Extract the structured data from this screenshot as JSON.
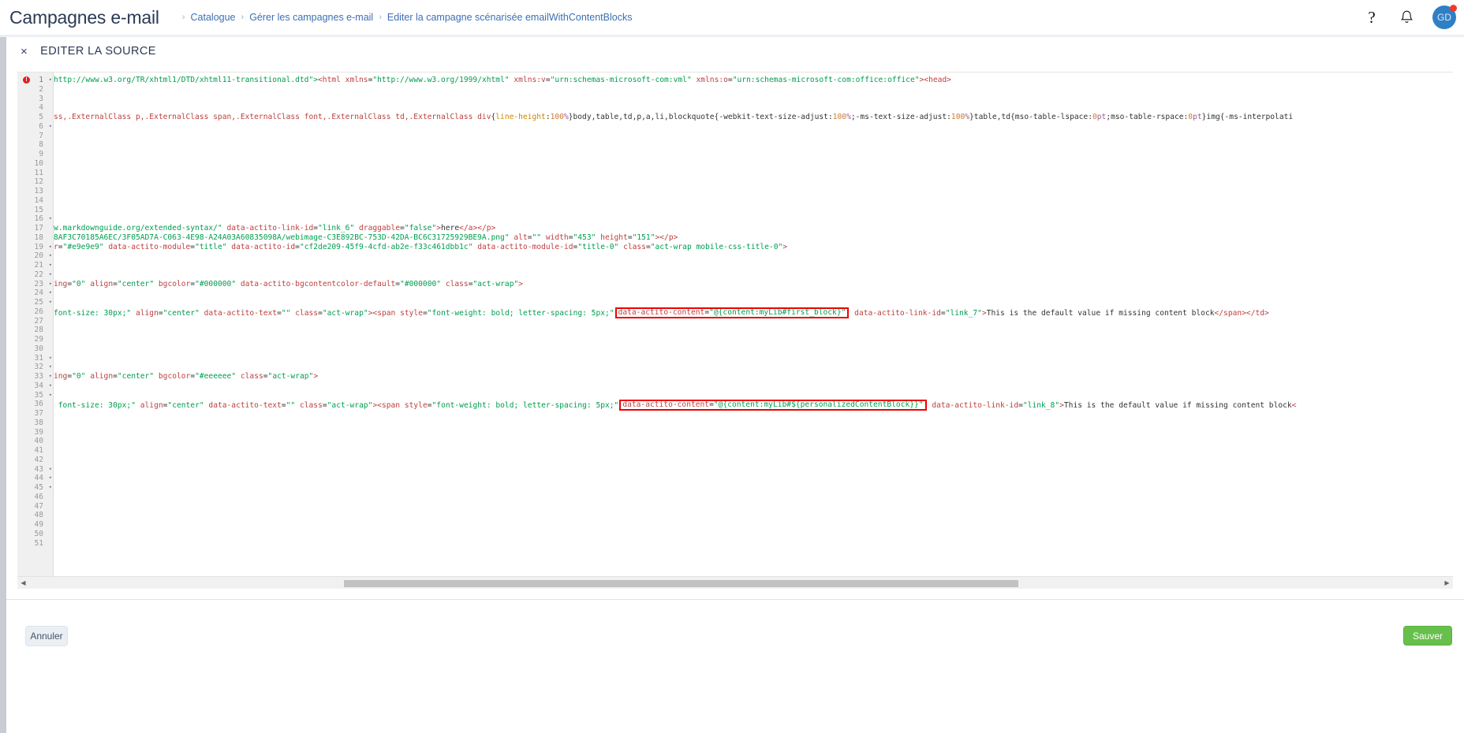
{
  "header": {
    "title": "Campagnes e-mail",
    "breadcrumb": [
      {
        "label": "Catalogue"
      },
      {
        "label": "Gérer les campagnes e-mail"
      },
      {
        "label": "Editer la campagne scénarisée emailWithContentBlocks"
      }
    ],
    "separator": "›",
    "help_icon": "?",
    "bell_icon": "bell-icon",
    "avatar_initials": "GD"
  },
  "panel": {
    "close_label": "×",
    "title": "EDITER LA SOURCE"
  },
  "editor": {
    "error_marker": "!",
    "total_lines": 51,
    "fold_lines": [
      1,
      6,
      16,
      19,
      20,
      21,
      22,
      23,
      24,
      25,
      31,
      32,
      33,
      34,
      35,
      43,
      44,
      45
    ],
    "lines": [
      {
        "n": 1,
        "tokens": [
          {
            "t": "http://www.w3.org/TR/xhtml1/DTD/xhtml11-transitional.dtd\">",
            "c": "t-str"
          },
          {
            "t": "<html ",
            "c": "t-tag"
          },
          {
            "t": "xmlns",
            "c": "t-attr"
          },
          {
            "t": "=",
            "c": "t-plain"
          },
          {
            "t": "\"http://www.w3.org/1999/xhtml\"",
            "c": "t-str"
          },
          {
            "t": " ",
            "c": "t-plain"
          },
          {
            "t": "xmlns:v",
            "c": "t-attr"
          },
          {
            "t": "=",
            "c": "t-plain"
          },
          {
            "t": "\"urn:schemas-microsoft-com:vml\"",
            "c": "t-str"
          },
          {
            "t": " ",
            "c": "t-plain"
          },
          {
            "t": "xmlns:o",
            "c": "t-attr"
          },
          {
            "t": "=",
            "c": "t-plain"
          },
          {
            "t": "\"urn:schemas-microsoft-com:office:office\"",
            "c": "t-str"
          },
          {
            "t": "><head>",
            "c": "t-tag"
          }
        ]
      },
      {
        "n": 5,
        "tokens": [
          {
            "t": "ss,.ExternalClass p,.ExternalClass span,.ExternalClass font,.ExternalClass td,.ExternalClass div",
            "c": "t-attr"
          },
          {
            "t": "{",
            "c": "t-plain"
          },
          {
            "t": "line-height",
            "c": "t-css-prop"
          },
          {
            "t": ":",
            "c": "t-plain"
          },
          {
            "t": "100",
            "c": "t-num"
          },
          {
            "t": "%",
            "c": "t-pct"
          },
          {
            "t": "}body,table,td,p,a,li,blockquote{-webkit-text-size-adjust:",
            "c": "t-plain"
          },
          {
            "t": "100",
            "c": "t-num"
          },
          {
            "t": "%",
            "c": "t-pct"
          },
          {
            "t": ";-ms-text-size-adjust:",
            "c": "t-plain"
          },
          {
            "t": "100",
            "c": "t-num"
          },
          {
            "t": "%",
            "c": "t-pct"
          },
          {
            "t": "}table,td{mso-table-lspace:",
            "c": "t-plain"
          },
          {
            "t": "0",
            "c": "t-num"
          },
          {
            "t": "pt",
            "c": "t-pct"
          },
          {
            "t": ";mso-table-rspace:",
            "c": "t-plain"
          },
          {
            "t": "0",
            "c": "t-num"
          },
          {
            "t": "pt",
            "c": "t-pct"
          },
          {
            "t": "}img{-ms-interpolati",
            "c": "t-plain"
          }
        ]
      },
      {
        "n": 17,
        "tokens": [
          {
            "t": "w.markdownguide.org/extended-syntax/\"",
            "c": "t-str"
          },
          {
            "t": " ",
            "c": "t-plain"
          },
          {
            "t": "data-actito-link-id",
            "c": "t-attr"
          },
          {
            "t": "=",
            "c": "t-plain"
          },
          {
            "t": "\"link_6\"",
            "c": "t-str"
          },
          {
            "t": " ",
            "c": "t-plain"
          },
          {
            "t": "draggable",
            "c": "t-attr"
          },
          {
            "t": "=",
            "c": "t-plain"
          },
          {
            "t": "\"false\"",
            "c": "t-str"
          },
          {
            "t": ">",
            "c": "t-tag"
          },
          {
            "t": "here",
            "c": "t-text"
          },
          {
            "t": "</a></p>",
            "c": "t-tag"
          }
        ]
      },
      {
        "n": 18,
        "tokens": [
          {
            "t": "8AF3C70185A6EC/3F05AD7A-C063-4E98-A24A03A60835098A/webimage-C3E892BC-753D-42DA-BC6C31725929BE9A.png\"",
            "c": "t-str"
          },
          {
            "t": " ",
            "c": "t-plain"
          },
          {
            "t": "alt",
            "c": "t-attr"
          },
          {
            "t": "=",
            "c": "t-plain"
          },
          {
            "t": "\"\"",
            "c": "t-str"
          },
          {
            "t": " ",
            "c": "t-plain"
          },
          {
            "t": "width",
            "c": "t-attr"
          },
          {
            "t": "=",
            "c": "t-plain"
          },
          {
            "t": "\"453\"",
            "c": "t-str"
          },
          {
            "t": " ",
            "c": "t-plain"
          },
          {
            "t": "height",
            "c": "t-attr"
          },
          {
            "t": "=",
            "c": "t-plain"
          },
          {
            "t": "\"151\"",
            "c": "t-str"
          },
          {
            "t": "></p>",
            "c": "t-tag"
          }
        ]
      },
      {
        "n": 19,
        "tokens": [
          {
            "t": "r",
            "c": "t-attr"
          },
          {
            "t": "=",
            "c": "t-plain"
          },
          {
            "t": "\"#e9e9e9\"",
            "c": "t-str"
          },
          {
            "t": " ",
            "c": "t-plain"
          },
          {
            "t": "data-actito-module",
            "c": "t-attr"
          },
          {
            "t": "=",
            "c": "t-plain"
          },
          {
            "t": "\"title\"",
            "c": "t-str"
          },
          {
            "t": " ",
            "c": "t-plain"
          },
          {
            "t": "data-actito-id",
            "c": "t-attr"
          },
          {
            "t": "=",
            "c": "t-plain"
          },
          {
            "t": "\"cf2de209-45f9-4cfd-ab2e-f33c461dbb1c\"",
            "c": "t-str"
          },
          {
            "t": " ",
            "c": "t-plain"
          },
          {
            "t": "data-actito-module-id",
            "c": "t-attr"
          },
          {
            "t": "=",
            "c": "t-plain"
          },
          {
            "t": "\"title-0\"",
            "c": "t-str"
          },
          {
            "t": " ",
            "c": "t-plain"
          },
          {
            "t": "class",
            "c": "t-attr"
          },
          {
            "t": "=",
            "c": "t-plain"
          },
          {
            "t": "\"act-wrap mobile-css-title-0\"",
            "c": "t-str"
          },
          {
            "t": ">",
            "c": "t-tag"
          }
        ]
      },
      {
        "n": 23,
        "tokens": [
          {
            "t": "ing",
            "c": "t-attr"
          },
          {
            "t": "=",
            "c": "t-plain"
          },
          {
            "t": "\"0\"",
            "c": "t-str"
          },
          {
            "t": " ",
            "c": "t-plain"
          },
          {
            "t": "align",
            "c": "t-attr"
          },
          {
            "t": "=",
            "c": "t-plain"
          },
          {
            "t": "\"center\"",
            "c": "t-str"
          },
          {
            "t": " ",
            "c": "t-plain"
          },
          {
            "t": "bgcolor",
            "c": "t-attr"
          },
          {
            "t": "=",
            "c": "t-plain"
          },
          {
            "t": "\"#000000\"",
            "c": "t-str"
          },
          {
            "t": " ",
            "c": "t-plain"
          },
          {
            "t": "data-actito-bgcontentcolor-default",
            "c": "t-attr"
          },
          {
            "t": "=",
            "c": "t-plain"
          },
          {
            "t": "\"#000000\"",
            "c": "t-str"
          },
          {
            "t": " ",
            "c": "t-plain"
          },
          {
            "t": "class",
            "c": "t-attr"
          },
          {
            "t": "=",
            "c": "t-plain"
          },
          {
            "t": "\"act-wrap\"",
            "c": "t-str"
          },
          {
            "t": ">",
            "c": "t-tag"
          }
        ]
      },
      {
        "n": 26,
        "highlight_after": 7,
        "tokens": [
          {
            "t": "font-size: 30px;\"",
            "c": "t-str"
          },
          {
            "t": " ",
            "c": "t-plain"
          },
          {
            "t": "align",
            "c": "t-attr"
          },
          {
            "t": "=",
            "c": "t-plain"
          },
          {
            "t": "\"center\"",
            "c": "t-str"
          },
          {
            "t": " ",
            "c": "t-plain"
          },
          {
            "t": "data-actito-text",
            "c": "t-attr"
          },
          {
            "t": "=",
            "c": "t-plain"
          },
          {
            "t": "\"\"",
            "c": "t-str"
          },
          {
            "t": " ",
            "c": "t-plain"
          },
          {
            "t": "class",
            "c": "t-attr"
          },
          {
            "t": "=",
            "c": "t-plain"
          },
          {
            "t": "\"act-wrap\"",
            "c": "t-str"
          },
          {
            "t": "><span ",
            "c": "t-tag"
          },
          {
            "t": "style",
            "c": "t-attr"
          },
          {
            "t": "=",
            "c": "t-plain"
          },
          {
            "t": "\"font-weight: bold; letter-spacing: 5px;\"",
            "c": "t-str"
          }
        ],
        "boxed": [
          {
            "t": "data-actito-content",
            "c": "t-attr"
          },
          {
            "t": "=",
            "c": "t-plain"
          },
          {
            "t": "\"@{content:myLib#first_block}\"",
            "c": "t-str"
          }
        ],
        "tail": [
          {
            "t": " ",
            "c": "t-plain"
          },
          {
            "t": "data-actito-link-id",
            "c": "t-attr"
          },
          {
            "t": "=",
            "c": "t-plain"
          },
          {
            "t": "\"link_7\"",
            "c": "t-str"
          },
          {
            "t": ">",
            "c": "t-tag"
          },
          {
            "t": "This is the default value if missing content block",
            "c": "t-text"
          },
          {
            "t": "</span></td>",
            "c": "t-tag"
          }
        ]
      },
      {
        "n": 33,
        "tokens": [
          {
            "t": "ing",
            "c": "t-attr"
          },
          {
            "t": "=",
            "c": "t-plain"
          },
          {
            "t": "\"0\"",
            "c": "t-str"
          },
          {
            "t": " ",
            "c": "t-plain"
          },
          {
            "t": "align",
            "c": "t-attr"
          },
          {
            "t": "=",
            "c": "t-plain"
          },
          {
            "t": "\"center\"",
            "c": "t-str"
          },
          {
            "t": " ",
            "c": "t-plain"
          },
          {
            "t": "bgcolor",
            "c": "t-attr"
          },
          {
            "t": "=",
            "c": "t-plain"
          },
          {
            "t": "\"#eeeeee\"",
            "c": "t-str"
          },
          {
            "t": " ",
            "c": "t-plain"
          },
          {
            "t": "class",
            "c": "t-attr"
          },
          {
            "t": "=",
            "c": "t-plain"
          },
          {
            "t": "\"act-wrap\"",
            "c": "t-str"
          },
          {
            "t": ">",
            "c": "t-tag"
          }
        ]
      },
      {
        "n": 36,
        "highlight_after": 7,
        "tokens": [
          {
            "t": " font-size: 30px;\"",
            "c": "t-str"
          },
          {
            "t": " ",
            "c": "t-plain"
          },
          {
            "t": "align",
            "c": "t-attr"
          },
          {
            "t": "=",
            "c": "t-plain"
          },
          {
            "t": "\"center\"",
            "c": "t-str"
          },
          {
            "t": " ",
            "c": "t-plain"
          },
          {
            "t": "data-actito-text",
            "c": "t-attr"
          },
          {
            "t": "=",
            "c": "t-plain"
          },
          {
            "t": "\"\"",
            "c": "t-str"
          },
          {
            "t": " ",
            "c": "t-plain"
          },
          {
            "t": "class",
            "c": "t-attr"
          },
          {
            "t": "=",
            "c": "t-plain"
          },
          {
            "t": "\"act-wrap\"",
            "c": "t-str"
          },
          {
            "t": "><span ",
            "c": "t-tag"
          },
          {
            "t": "style",
            "c": "t-attr"
          },
          {
            "t": "=",
            "c": "t-plain"
          },
          {
            "t": "\"font-weight: bold; letter-spacing: 5px;\"",
            "c": "t-str"
          }
        ],
        "boxed": [
          {
            "t": "data-actito-content",
            "c": "t-attr"
          },
          {
            "t": "=",
            "c": "t-plain"
          },
          {
            "t": "\"@{content:myLib#${personalizedContentBlock}}\"",
            "c": "t-str"
          }
        ],
        "tail": [
          {
            "t": " ",
            "c": "t-plain"
          },
          {
            "t": "data-actito-link-id",
            "c": "t-attr"
          },
          {
            "t": "=",
            "c": "t-plain"
          },
          {
            "t": "\"link_8\"",
            "c": "t-str"
          },
          {
            "t": ">",
            "c": "t-tag"
          },
          {
            "t": "This is the default value if missing content block",
            "c": "t-text"
          },
          {
            "t": "<",
            "c": "t-tag"
          }
        ]
      }
    ]
  },
  "footer": {
    "cancel_label": "Annuler",
    "save_label": "Sauver"
  },
  "colors": {
    "accent_blue": "#3d6fb4",
    "save_green": "#67bf4c",
    "error_red": "#e02020",
    "highlight_red": "#ee0000",
    "avatar_blue": "#2f7fc5"
  }
}
